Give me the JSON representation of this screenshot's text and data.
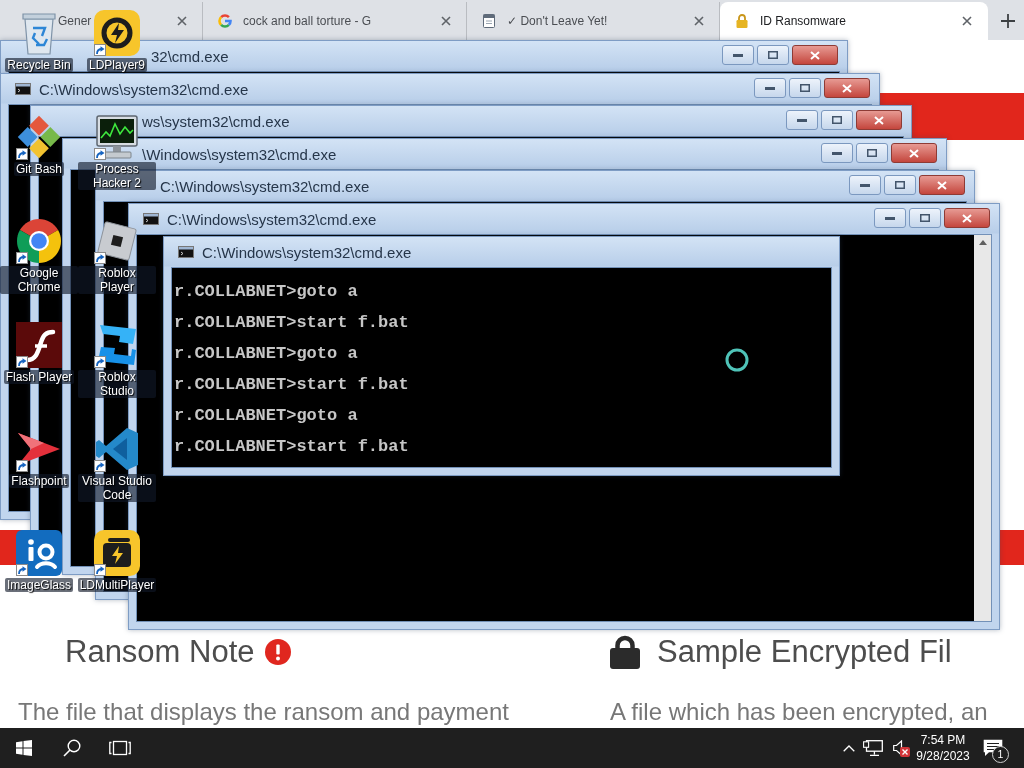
{
  "browser": {
    "tabs": [
      {
        "title": "Gener",
        "selected": false
      },
      {
        "title": "cock and ball torture - G",
        "selected": false
      },
      {
        "title": "✓ Don't Leave Yet!",
        "selected": false
      },
      {
        "title": "ID Ransomware",
        "selected": true
      }
    ],
    "features": [
      {
        "heading": "Ransom Note",
        "description": "The file that displays the ransom and payment",
        "alert": true
      },
      {
        "heading": "Sample Encrypted Fil",
        "description": "A file which has been encrypted, an",
        "alert": false
      }
    ]
  },
  "cmd_windows": [
    {
      "title": "32\\cmd.exe"
    },
    {
      "title": "C:\\Windows\\system32\\cmd.exe"
    },
    {
      "title": "ws\\system32\\cmd.exe"
    },
    {
      "title": "\\Windows\\system32\\cmd.exe"
    },
    {
      "title": "C:\\Windows\\system32\\cmd.exe"
    },
    {
      "title": "C:\\Windows\\system32\\cmd.exe"
    },
    {
      "title": "C:\\Windows\\system32\\cmd.exe",
      "lines": [
        "r.COLLABNET>goto a",
        "r.COLLABNET>start f.bat",
        "r.COLLABNET>goto a",
        "r.COLLABNET>start f.bat",
        "r.COLLABNET>goto a",
        "r.COLLABNET>start f.bat"
      ]
    }
  ],
  "desktop_icons": [
    {
      "label": "Recycle Bin",
      "shortcut": false
    },
    {
      "label": "LDPlayer9",
      "shortcut": true
    },
    {
      "label": "Git Bash",
      "shortcut": true
    },
    {
      "label": "Process Hacker 2",
      "shortcut": true
    },
    {
      "label": "Google Chrome",
      "shortcut": true
    },
    {
      "label": "Roblox Player",
      "shortcut": true
    },
    {
      "label": "Flash Player",
      "shortcut": true
    },
    {
      "label": "Roblox Studio",
      "shortcut": true
    },
    {
      "label": "Flashpoint",
      "shortcut": true
    },
    {
      "label": "Visual Studio Code",
      "shortcut": true
    },
    {
      "label": "ImageGlass",
      "shortcut": true
    },
    {
      "label": "LDMultiPlayer",
      "shortcut": true
    }
  ],
  "taskbar": {
    "time": "7:54 PM",
    "date": "9/28/2023",
    "volume_muted": true,
    "notification_count": "1"
  }
}
